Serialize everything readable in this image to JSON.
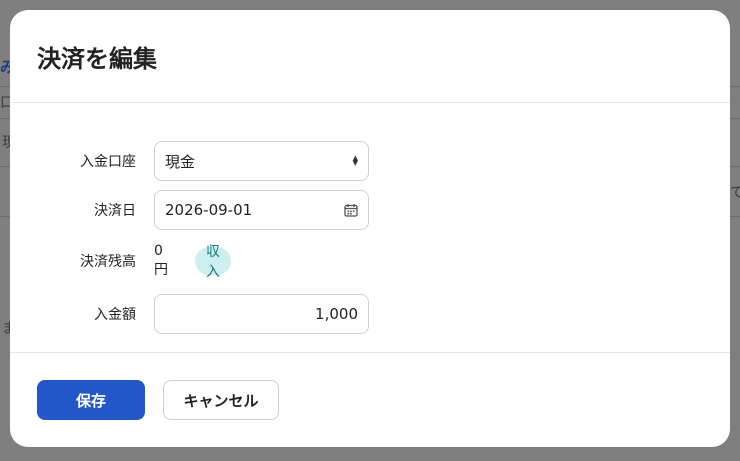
{
  "background": {
    "link_fragment": "み",
    "cell_fragment_1": "口",
    "cell_fragment_2": "現",
    "cell_fragment_3": "ま",
    "cell_fragment_4": "て"
  },
  "dialog": {
    "title": "決済を編集",
    "fields": {
      "account_label": "入金口座",
      "account_value": "現金",
      "date_label": "決済日",
      "date_value": "2026-09-01",
      "balance_label": "決済残高",
      "balance_value": "0円",
      "balance_badge": "収入",
      "amount_label": "入金額",
      "amount_value": "1,000"
    },
    "footer": {
      "save_label": "保存",
      "cancel_label": "キャンセル"
    }
  },
  "colors": {
    "primary": "#2358c9",
    "badge_bg": "#cdeff0",
    "badge_text": "#117a80",
    "overlay": "#7f7f7f"
  },
  "icons": {
    "select_arrows": "select-arrows-icon",
    "calendar": "calendar-icon"
  }
}
